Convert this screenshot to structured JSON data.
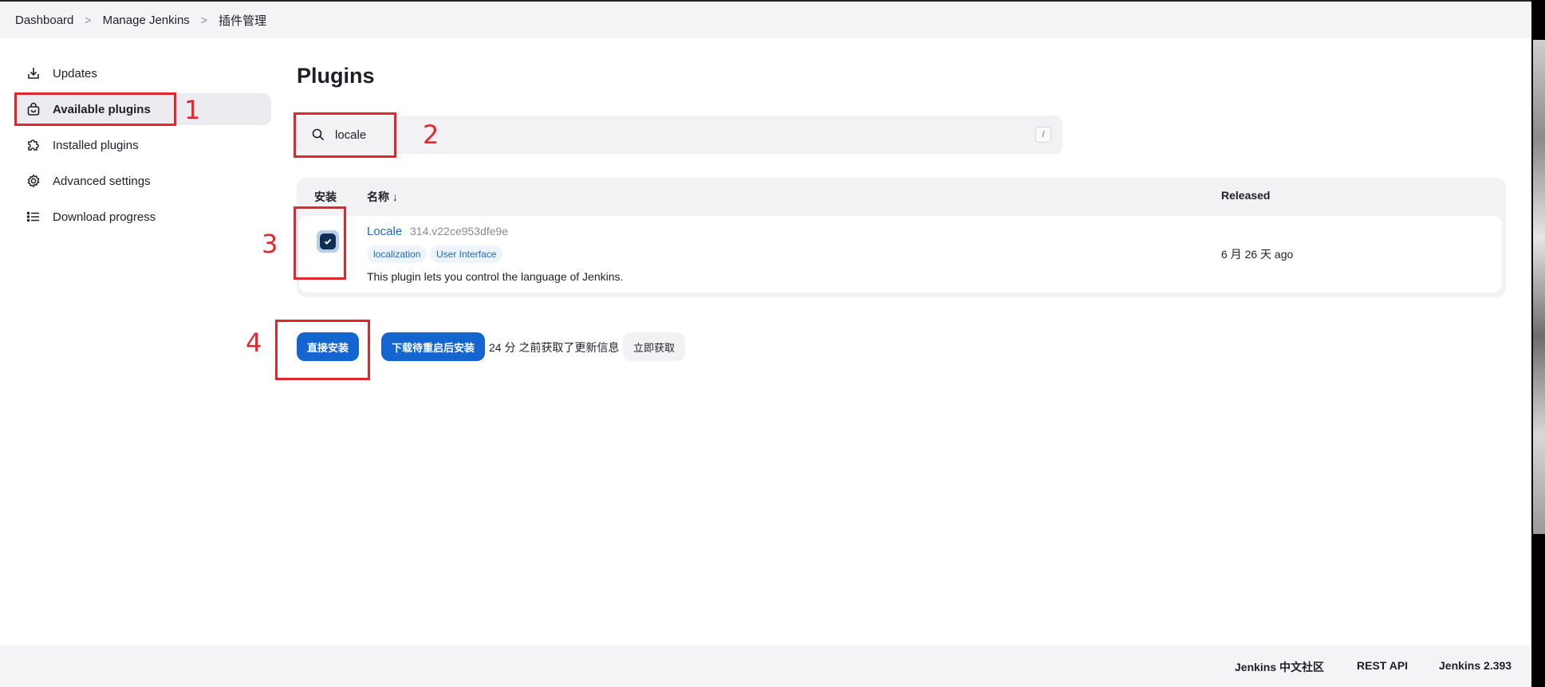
{
  "breadcrumb": {
    "items": [
      "Dashboard",
      "Manage Jenkins",
      "插件管理"
    ],
    "separator": ">"
  },
  "sidebar": {
    "items": [
      {
        "label": "Updates",
        "icon": "download-icon",
        "active": false
      },
      {
        "label": "Available plugins",
        "icon": "shopping-bag-icon",
        "active": true
      },
      {
        "label": "Installed plugins",
        "icon": "puzzle-icon",
        "active": false
      },
      {
        "label": "Advanced settings",
        "icon": "gear-icon",
        "active": false
      },
      {
        "label": "Download progress",
        "icon": "list-icon",
        "active": false
      }
    ]
  },
  "main": {
    "title": "Plugins",
    "search": {
      "value": "locale",
      "shortcut": "/"
    },
    "table": {
      "headers": {
        "install": "安装",
        "name": "名称 ↓",
        "released": "Released"
      },
      "rows": [
        {
          "checked": true,
          "name": "Locale",
          "version": "314.v22ce953dfe9e",
          "tags": [
            "localization",
            "User Interface"
          ],
          "description": "This plugin lets you control the language of Jenkins.",
          "released": "6 月 26 天 ago"
        }
      ]
    },
    "actions": {
      "install_now": "直接安装",
      "install_after_restart": "下载待重启后安装",
      "info": "24 分 之前获取了更新信息",
      "check_now": "立即获取"
    }
  },
  "annotations": [
    "1",
    "2",
    "3",
    "4"
  ],
  "footer": {
    "links": [
      "Jenkins 中文社区",
      "REST API",
      "Jenkins 2.393"
    ]
  },
  "colors": {
    "accent": "#1465cf",
    "annotation": "#e3262b",
    "checkbox": "#0f2f57",
    "link": "#1d6ac8"
  }
}
